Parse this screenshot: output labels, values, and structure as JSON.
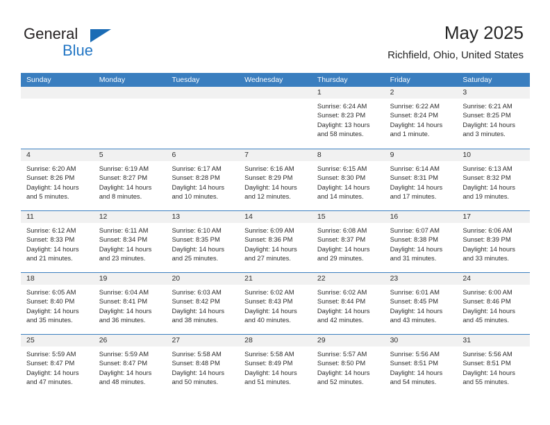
{
  "brand": {
    "word1": "General",
    "word2": "Blue",
    "accent_color": "#2276c4",
    "triangle_color": "#1b6cb5"
  },
  "header": {
    "title": "May 2025",
    "subtitle": "Richfield, Ohio, United States"
  },
  "calendar": {
    "header_bg": "#3a7ebf",
    "daynum_bg": "#f1f1f1",
    "weekdays": [
      "Sunday",
      "Monday",
      "Tuesday",
      "Wednesday",
      "Thursday",
      "Friday",
      "Saturday"
    ],
    "weeks": [
      [
        {
          "day": "",
          "lines": []
        },
        {
          "day": "",
          "lines": []
        },
        {
          "day": "",
          "lines": []
        },
        {
          "day": "",
          "lines": []
        },
        {
          "day": "1",
          "lines": [
            "Sunrise: 6:24 AM",
            "Sunset: 8:23 PM",
            "Daylight: 13 hours",
            "and 58 minutes."
          ]
        },
        {
          "day": "2",
          "lines": [
            "Sunrise: 6:22 AM",
            "Sunset: 8:24 PM",
            "Daylight: 14 hours",
            "and 1 minute."
          ]
        },
        {
          "day": "3",
          "lines": [
            "Sunrise: 6:21 AM",
            "Sunset: 8:25 PM",
            "Daylight: 14 hours",
            "and 3 minutes."
          ]
        }
      ],
      [
        {
          "day": "4",
          "lines": [
            "Sunrise: 6:20 AM",
            "Sunset: 8:26 PM",
            "Daylight: 14 hours",
            "and 5 minutes."
          ]
        },
        {
          "day": "5",
          "lines": [
            "Sunrise: 6:19 AM",
            "Sunset: 8:27 PM",
            "Daylight: 14 hours",
            "and 8 minutes."
          ]
        },
        {
          "day": "6",
          "lines": [
            "Sunrise: 6:17 AM",
            "Sunset: 8:28 PM",
            "Daylight: 14 hours",
            "and 10 minutes."
          ]
        },
        {
          "day": "7",
          "lines": [
            "Sunrise: 6:16 AM",
            "Sunset: 8:29 PM",
            "Daylight: 14 hours",
            "and 12 minutes."
          ]
        },
        {
          "day": "8",
          "lines": [
            "Sunrise: 6:15 AM",
            "Sunset: 8:30 PM",
            "Daylight: 14 hours",
            "and 14 minutes."
          ]
        },
        {
          "day": "9",
          "lines": [
            "Sunrise: 6:14 AM",
            "Sunset: 8:31 PM",
            "Daylight: 14 hours",
            "and 17 minutes."
          ]
        },
        {
          "day": "10",
          "lines": [
            "Sunrise: 6:13 AM",
            "Sunset: 8:32 PM",
            "Daylight: 14 hours",
            "and 19 minutes."
          ]
        }
      ],
      [
        {
          "day": "11",
          "lines": [
            "Sunrise: 6:12 AM",
            "Sunset: 8:33 PM",
            "Daylight: 14 hours",
            "and 21 minutes."
          ]
        },
        {
          "day": "12",
          "lines": [
            "Sunrise: 6:11 AM",
            "Sunset: 8:34 PM",
            "Daylight: 14 hours",
            "and 23 minutes."
          ]
        },
        {
          "day": "13",
          "lines": [
            "Sunrise: 6:10 AM",
            "Sunset: 8:35 PM",
            "Daylight: 14 hours",
            "and 25 minutes."
          ]
        },
        {
          "day": "14",
          "lines": [
            "Sunrise: 6:09 AM",
            "Sunset: 8:36 PM",
            "Daylight: 14 hours",
            "and 27 minutes."
          ]
        },
        {
          "day": "15",
          "lines": [
            "Sunrise: 6:08 AM",
            "Sunset: 8:37 PM",
            "Daylight: 14 hours",
            "and 29 minutes."
          ]
        },
        {
          "day": "16",
          "lines": [
            "Sunrise: 6:07 AM",
            "Sunset: 8:38 PM",
            "Daylight: 14 hours",
            "and 31 minutes."
          ]
        },
        {
          "day": "17",
          "lines": [
            "Sunrise: 6:06 AM",
            "Sunset: 8:39 PM",
            "Daylight: 14 hours",
            "and 33 minutes."
          ]
        }
      ],
      [
        {
          "day": "18",
          "lines": [
            "Sunrise: 6:05 AM",
            "Sunset: 8:40 PM",
            "Daylight: 14 hours",
            "and 35 minutes."
          ]
        },
        {
          "day": "19",
          "lines": [
            "Sunrise: 6:04 AM",
            "Sunset: 8:41 PM",
            "Daylight: 14 hours",
            "and 36 minutes."
          ]
        },
        {
          "day": "20",
          "lines": [
            "Sunrise: 6:03 AM",
            "Sunset: 8:42 PM",
            "Daylight: 14 hours",
            "and 38 minutes."
          ]
        },
        {
          "day": "21",
          "lines": [
            "Sunrise: 6:02 AM",
            "Sunset: 8:43 PM",
            "Daylight: 14 hours",
            "and 40 minutes."
          ]
        },
        {
          "day": "22",
          "lines": [
            "Sunrise: 6:02 AM",
            "Sunset: 8:44 PM",
            "Daylight: 14 hours",
            "and 42 minutes."
          ]
        },
        {
          "day": "23",
          "lines": [
            "Sunrise: 6:01 AM",
            "Sunset: 8:45 PM",
            "Daylight: 14 hours",
            "and 43 minutes."
          ]
        },
        {
          "day": "24",
          "lines": [
            "Sunrise: 6:00 AM",
            "Sunset: 8:46 PM",
            "Daylight: 14 hours",
            "and 45 minutes."
          ]
        }
      ],
      [
        {
          "day": "25",
          "lines": [
            "Sunrise: 5:59 AM",
            "Sunset: 8:47 PM",
            "Daylight: 14 hours",
            "and 47 minutes."
          ]
        },
        {
          "day": "26",
          "lines": [
            "Sunrise: 5:59 AM",
            "Sunset: 8:47 PM",
            "Daylight: 14 hours",
            "and 48 minutes."
          ]
        },
        {
          "day": "27",
          "lines": [
            "Sunrise: 5:58 AM",
            "Sunset: 8:48 PM",
            "Daylight: 14 hours",
            "and 50 minutes."
          ]
        },
        {
          "day": "28",
          "lines": [
            "Sunrise: 5:58 AM",
            "Sunset: 8:49 PM",
            "Daylight: 14 hours",
            "and 51 minutes."
          ]
        },
        {
          "day": "29",
          "lines": [
            "Sunrise: 5:57 AM",
            "Sunset: 8:50 PM",
            "Daylight: 14 hours",
            "and 52 minutes."
          ]
        },
        {
          "day": "30",
          "lines": [
            "Sunrise: 5:56 AM",
            "Sunset: 8:51 PM",
            "Daylight: 14 hours",
            "and 54 minutes."
          ]
        },
        {
          "day": "31",
          "lines": [
            "Sunrise: 5:56 AM",
            "Sunset: 8:51 PM",
            "Daylight: 14 hours",
            "and 55 minutes."
          ]
        }
      ]
    ]
  }
}
